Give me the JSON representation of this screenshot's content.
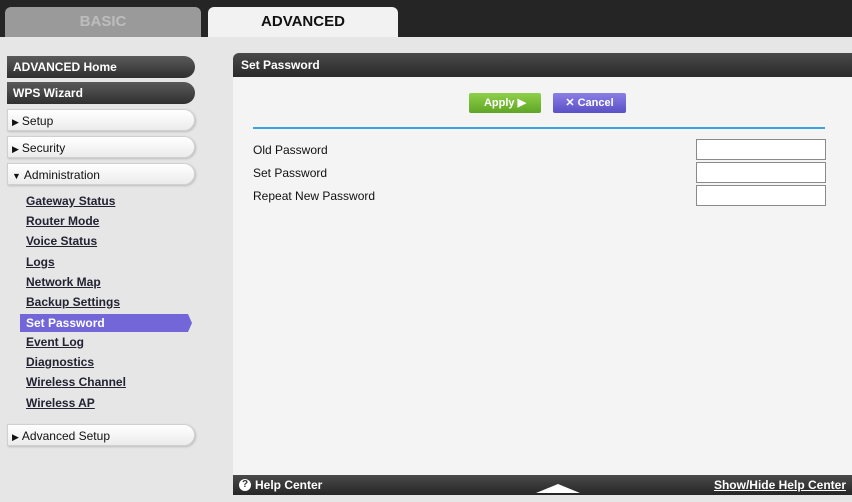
{
  "tabs": {
    "basic": "BASIC",
    "advanced": "ADVANCED"
  },
  "sidebar": {
    "advanced_home": "ADVANCED Home",
    "wps_wizard": "WPS Wizard",
    "setup": "Setup",
    "security": "Security",
    "administration": "Administration",
    "admin_links": [
      "Gateway Status",
      "Router Mode",
      "Voice Status",
      "Logs",
      "Network Map",
      "Backup Settings",
      "Set Password",
      "Event Log",
      "Diagnostics",
      "Wireless Channel",
      "Wireless AP"
    ],
    "advanced_setup": "Advanced Setup"
  },
  "panel": {
    "title": "Set Password",
    "apply": "Apply ▶",
    "cancel": "✕ Cancel",
    "fields": [
      {
        "label": "Old Password",
        "value": ""
      },
      {
        "label": "Set Password",
        "value": ""
      },
      {
        "label": "Repeat New Password",
        "value": ""
      }
    ]
  },
  "footer": {
    "help_icon": "?",
    "help_center": "Help Center",
    "show_hide": "Show/Hide Help Center"
  },
  "colors": {
    "active_item": "#7266d8",
    "apply": "#6cb52e",
    "cancel": "#6a5fd6",
    "divider": "#3ca3dc"
  }
}
